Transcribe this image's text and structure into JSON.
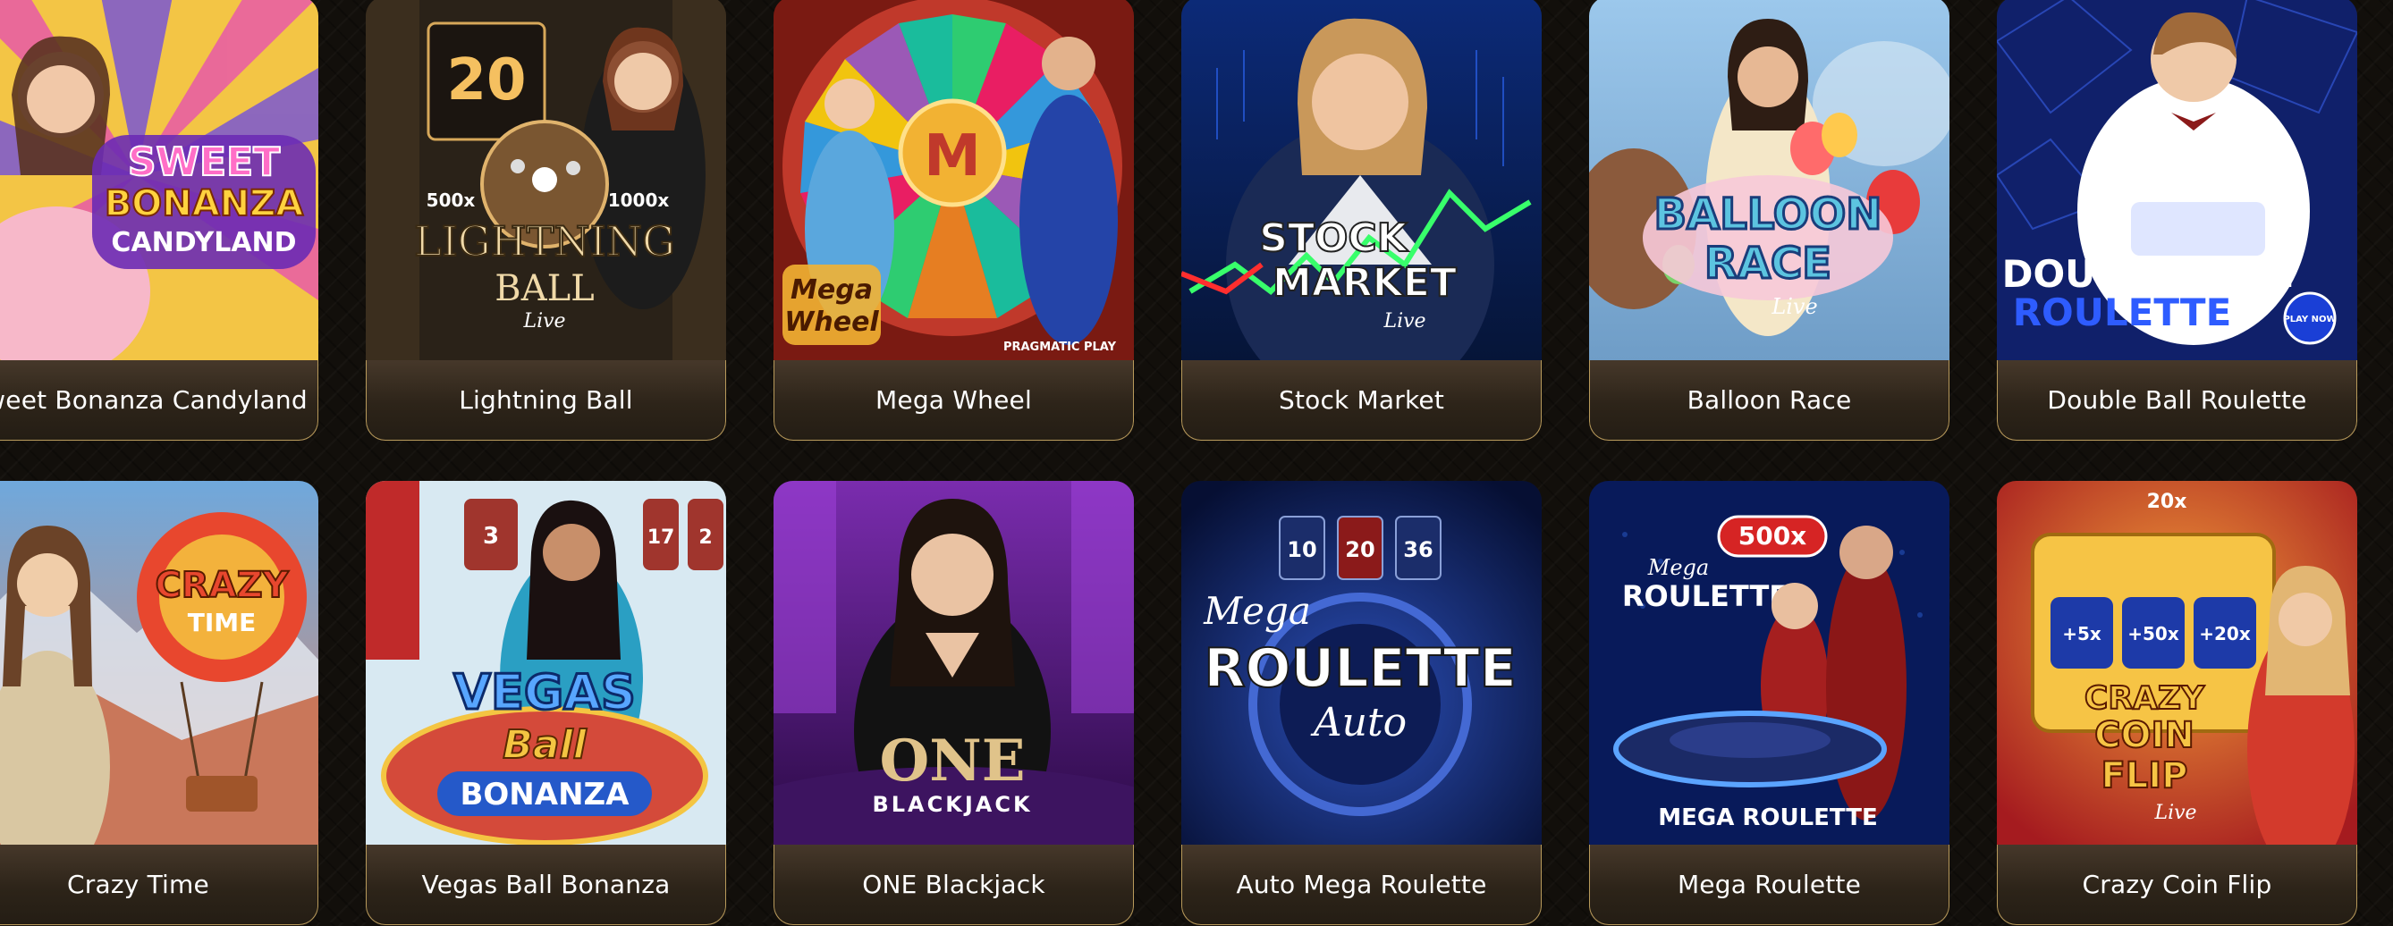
{
  "games": [
    {
      "title": "Sweet Bonanza Candyland",
      "logo_lines": [
        "SWEET",
        "BONANZA",
        "CANDYLAND"
      ],
      "theme": {
        "bg": "#f3c545",
        "accent": "#e64fb0",
        "person": "#f7b8c9"
      }
    },
    {
      "title": "Lightning Ball",
      "logo_lines": [
        "LIGHTNING",
        "BALL",
        "Live"
      ],
      "badge": "20",
      "multipliers": [
        "500x",
        "1000x"
      ],
      "theme": {
        "bg": "#2a2218",
        "accent": "#d7a85a",
        "person": "#1c1c1c"
      }
    },
    {
      "title": "Mega Wheel",
      "logo_lines": [
        "M",
        "Mega",
        "Wheel"
      ],
      "provider": "PRAGMATIC PLAY",
      "theme": {
        "bg": "#7a1a12",
        "accent": "#f2b233",
        "person": "#2444a8"
      }
    },
    {
      "title": "Stock Market",
      "logo_lines": [
        "STOCK",
        "MARKET",
        "Live"
      ],
      "theme": {
        "bg": "#0f2a6a",
        "accent": "#ffffff",
        "person": "#1a2a55"
      }
    },
    {
      "title": "Balloon Race",
      "logo_lines": [
        "BALLOON",
        "RACE",
        "Live"
      ],
      "theme": {
        "bg": "#86b9e2",
        "accent": "#5cc4e0",
        "person": "#f4e7c8"
      }
    },
    {
      "title": "Double Ball Roulette",
      "logo_lines": [
        "DOUBLE BALL",
        "ROULETTE",
        "PLAY NOW"
      ],
      "theme": {
        "bg": "#10206a",
        "accent": "#2e5cff",
        "person": "#ffffff"
      }
    },
    {
      "title": "Crazy Time",
      "logo_lines": [
        "CRAZY",
        "TIME"
      ],
      "theme": {
        "bg": "#7bb3e0",
        "accent": "#e8472e",
        "person": "#d9c7a2"
      }
    },
    {
      "title": "Vegas Ball Bonanza",
      "logo_lines": [
        "VEGAS",
        "Ball",
        "BONANZA"
      ],
      "numbers": [
        "3",
        "17",
        "2"
      ],
      "theme": {
        "bg": "#c9e3f1",
        "accent": "#3c74d4",
        "person": "#2a9fc3"
      }
    },
    {
      "title": "ONE Blackjack",
      "logo_lines": [
        "ONE",
        "BLACKJACK"
      ],
      "theme": {
        "bg": "#4a1a73",
        "accent": "#e0c38a",
        "person": "#121212"
      }
    },
    {
      "title": "Auto Mega Roulette",
      "logo_lines": [
        "Mega",
        "ROULETTE",
        "Auto"
      ],
      "numbers": [
        "10",
        "20",
        "36"
      ],
      "theme": {
        "bg": "#0b1a4d",
        "accent": "#ffffff",
        "person": "#1b3a8a"
      }
    },
    {
      "title": "Mega Roulette",
      "logo_lines": [
        "Mega",
        "ROULETTE",
        "MEGA ROULETTE"
      ],
      "badge": "500x",
      "theme": {
        "bg": "#081a5a",
        "accent": "#d62424",
        "person": "#a51f1f"
      }
    },
    {
      "title": "Crazy Coin Flip",
      "logo_lines": [
        "CRAZY",
        "COIN",
        "FLIP",
        "Live"
      ],
      "multipliers": [
        "+5x",
        "+50x",
        "+20x",
        "20x"
      ],
      "theme": {
        "bg": "#c8222a",
        "accent": "#f6c445",
        "person": "#d33a2c"
      }
    }
  ]
}
